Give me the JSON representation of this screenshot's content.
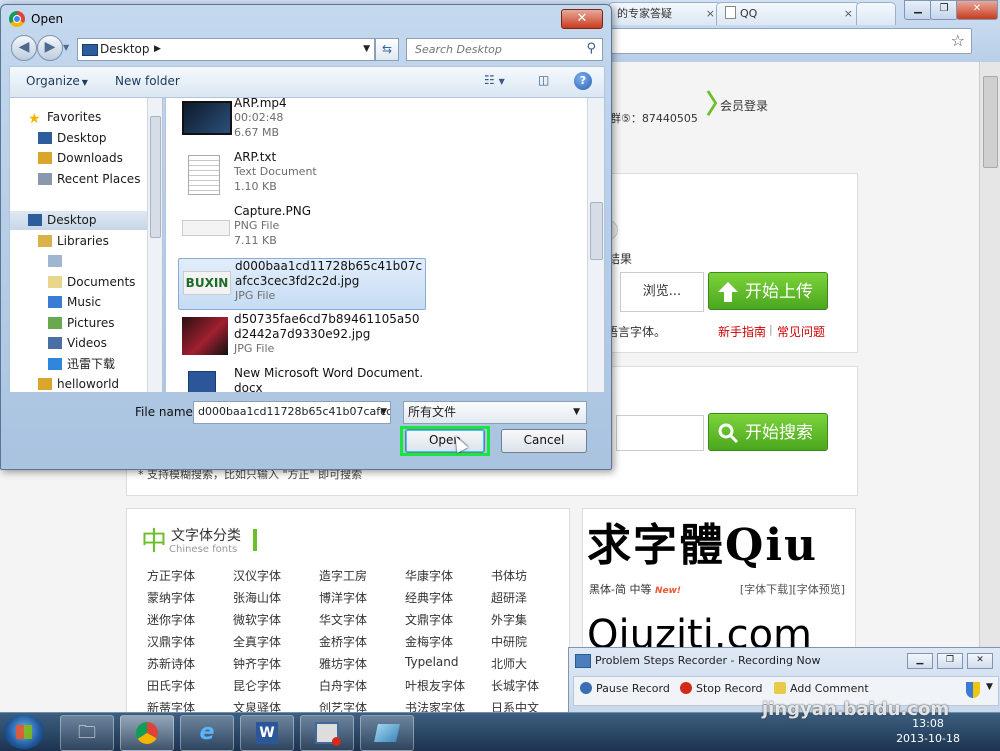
{
  "browser": {
    "tabs": [
      {
        "label": "的专家答疑"
      },
      {
        "label": "QQ"
      }
    ],
    "header": {
      "qq_group": "群⑤：87440505",
      "member_login": "会员登录"
    },
    "upload": {
      "result_label": "结果",
      "browse_label": "浏览...",
      "upload_button": "开始上传",
      "lang_note": "语言字体。",
      "guide_link": "新手指南",
      "separator": "|",
      "faq_link": "常见问题"
    },
    "search": {
      "button": "开始搜索",
      "tip": "* 支持模糊搜索，比如只输入 \"方正\" 即可搜索"
    },
    "font_category": {
      "title_big": "中",
      "title": "文字体分类",
      "subtitle": "Chinese fonts",
      "items": [
        "方正字体",
        "汉仪字体",
        "造字工房",
        "华康字体",
        "书体坊",
        "蒙纳字体",
        "张海山体",
        "博洋字体",
        "经典字体",
        "超研泽",
        "迷你字体",
        "微软字体",
        "华文字体",
        "文鼎字体",
        "外字集",
        "汉鼎字体",
        "全真字体",
        "金桥字体",
        "金梅字体",
        "中研院",
        "苏新诗体",
        "钟齐字体",
        "雅坊字体",
        "Typeland",
        "北师大",
        "田氏字体",
        "昆仑字体",
        "白舟字体",
        "叶根友字体",
        "长城字体",
        "新蒂字体",
        "文泉驿体",
        "创艺字体",
        "书法家字体",
        "日系中文"
      ]
    },
    "preview": {
      "sample1": "求字體Qiu",
      "caption": "黑体-简 中等",
      "new_badge": "New!",
      "links": "[字体下载][字体预览]",
      "sample2": "Qiuziti.com"
    }
  },
  "dialog": {
    "title": "Open",
    "close": "✕",
    "path": "Desktop",
    "search_placeholder": "Search Desktop",
    "organize": "Organize",
    "new_folder": "New folder",
    "help": "?",
    "nav": [
      {
        "label": "Favorites",
        "icon": "star-icon"
      },
      {
        "label": "Desktop",
        "icon": "desktop-icon"
      },
      {
        "label": "Downloads",
        "icon": "downloads-icon"
      },
      {
        "label": "Recent Places",
        "icon": "recent-places-icon"
      },
      {
        "label": "Desktop",
        "icon": "desktop-icon"
      },
      {
        "label": "Libraries",
        "icon": "libraries-icon"
      },
      {
        "label": "",
        "icon": "library-icon"
      },
      {
        "label": "Documents",
        "icon": "documents-icon"
      },
      {
        "label": "Music",
        "icon": "music-icon"
      },
      {
        "label": "Pictures",
        "icon": "pictures-icon"
      },
      {
        "label": "Videos",
        "icon": "videos-icon"
      },
      {
        "label": "迅雷下载",
        "icon": "thunder-download-icon"
      },
      {
        "label": "helloworld",
        "icon": "user-folder-icon"
      }
    ],
    "files": [
      {
        "name": "ARP.mp4",
        "type": "00:02:48",
        "size": "6.67 MB"
      },
      {
        "name": "ARP.txt",
        "type": "Text Document",
        "size": "1.10 KB"
      },
      {
        "name": "Capture.PNG",
        "type": "PNG File",
        "size": "7.11 KB"
      },
      {
        "name": "d000baa1cd11728b65c41b07cafcc3cec3fd2c2d.jpg",
        "type": "JPG File",
        "size": ""
      },
      {
        "name": "d50735fae6cd7b89461105a50d2442a7d9330e92.jpg",
        "type": "JPG File",
        "size": ""
      },
      {
        "name": "New Microsoft Word Document.docx",
        "type": "",
        "size": ""
      }
    ],
    "thumb_label": "BUXIN",
    "file_name_label": "File name:",
    "file_name_value": "d000baa1cd11728b65c41b07cafcc3",
    "file_type": "所有文件",
    "open_button": "Open",
    "cancel_button": "Cancel"
  },
  "psr": {
    "title": "Problem Steps Recorder - Recording Now",
    "pause": "Pause Record",
    "stop": "Stop Record",
    "add_comment": "Add Comment"
  },
  "taskbar": {
    "time": "13:08",
    "date": "2013-10-18"
  },
  "watermark": "jingyan.baidu.com",
  "colors": {
    "accent_green": "#6cbf2a",
    "highlight": "#14e83c",
    "link_red": "#cc0000"
  }
}
